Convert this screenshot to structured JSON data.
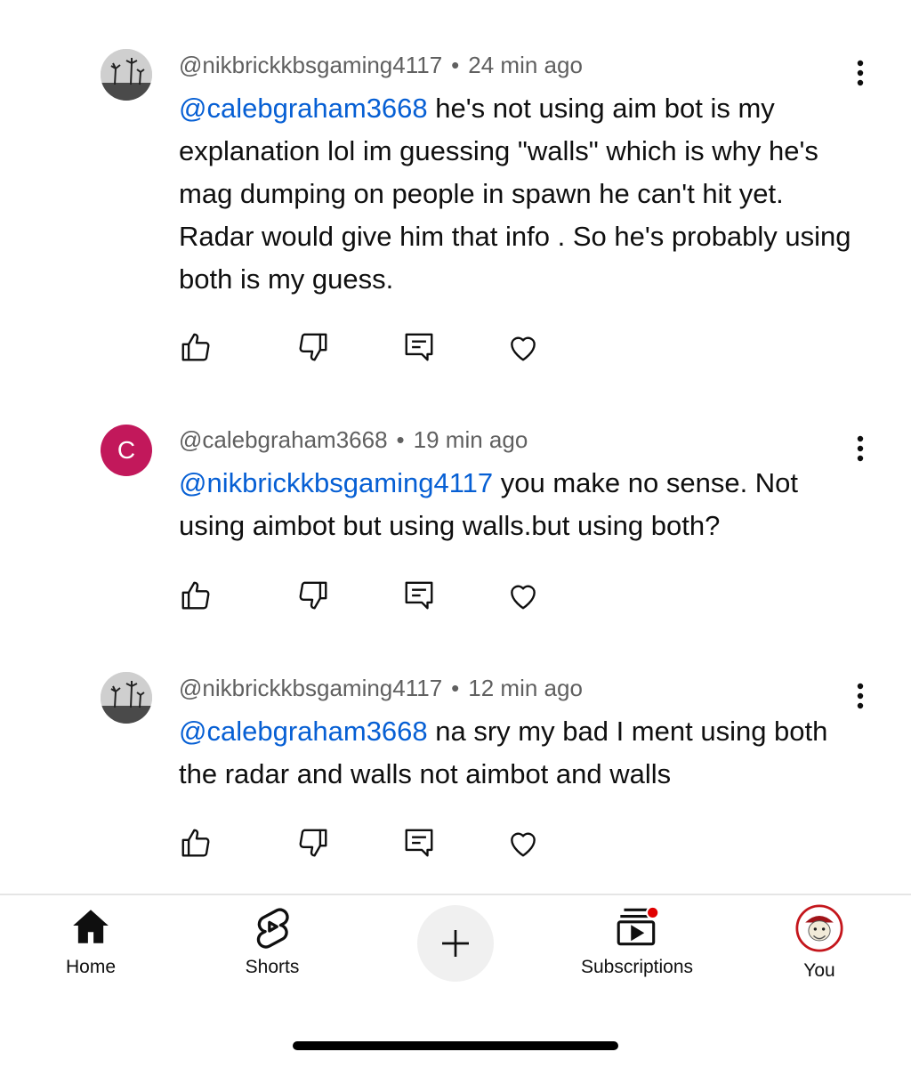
{
  "comments": [
    {
      "author": "@nikbrickkbsgaming4117",
      "time": "24 min ago",
      "mention": "@calebgraham3668",
      "text": " he's not using aim bot is my explanation lol im guessing \"walls\" which is why he's mag dumping on people in spawn he can't hit yet. Radar would give him that info . So he's probably using both is my guess.",
      "avatar": "photo"
    },
    {
      "author": "@calebgraham3668",
      "time": "19 min ago",
      "mention": "@nikbrickkbsgaming4117",
      "text": " you make no sense. Not using aimbot but using walls.but using both?",
      "avatar": "C"
    },
    {
      "author": "@nikbrickkbsgaming4117",
      "time": "12 min ago",
      "mention": "@calebgraham3668",
      "text": " na sry my bad I ment using both the radar and walls not aimbot and walls",
      "avatar": "photo"
    }
  ],
  "separator": "•",
  "nav": {
    "home": "Home",
    "shorts": "Shorts",
    "subscriptions": "Subscriptions",
    "you": "You"
  },
  "colors": {
    "mention": "#065fd4",
    "avatar_c": "#c2185b",
    "notification_dot": "#e00000"
  }
}
